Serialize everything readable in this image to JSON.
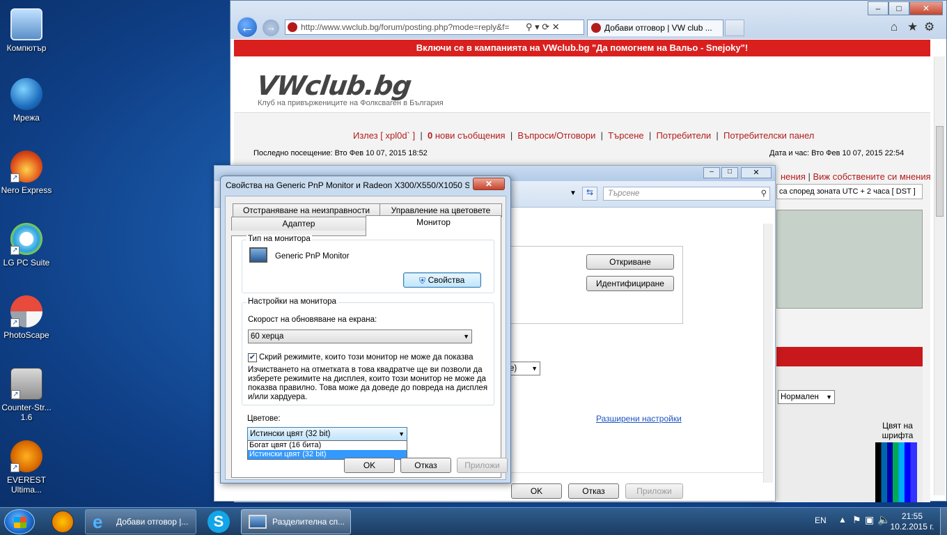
{
  "desktop": {
    "icons": [
      {
        "label": "Компютър",
        "name": "computer"
      },
      {
        "label": "Мрежа",
        "name": "network"
      },
      {
        "label": "Nero Express",
        "name": "nero"
      },
      {
        "label": "LG PC Suite",
        "name": "lg-pc-suite"
      },
      {
        "label": "PhotoScape",
        "name": "photoscape"
      },
      {
        "label": "Counter-Str... 1.6",
        "name": "counter-strike"
      },
      {
        "label": "EVEREST Ultima...",
        "name": "everest"
      }
    ]
  },
  "browser": {
    "url": "http://www.vwclub.bg/forum/posting.php?mode=reply&f=",
    "tab_title": "Добави отговор | VW club ...",
    "banner": "Включи се в кампанията на VWclub.bg \"Да помогнем на Вальо - Snejoky\"!",
    "logo": "VWclub.bg",
    "logo_sub": "Клуб на привържениците на Фолксваген в България",
    "nav": {
      "logout": "Излез [ xpl0d` ]",
      "new_count": "0",
      "new_msgs": " нови съобщения",
      "faq": "Въпроси/Отговори",
      "search": "Търсене",
      "users": "Потребители",
      "panel": "Потребителски панел"
    },
    "last_visit": "Последно посещение: Вто Фев 10 07, 2015 18:52",
    "datetime": "Дата и час: Вто Фев 10 07, 2015 22:54",
    "own_posts_prefix": "нения",
    "own_posts": "Виж собствените си мнения",
    "timezone": "са според зоната UTC + 2 часа [ DST ]",
    "font_size": "Нормален",
    "font_color_label": "Цвят на шрифта"
  },
  "display_dialog": {
    "search_placeholder": "Търсене",
    "detect_button": "Откриване",
    "identify_button": "Идентифициране",
    "advanced_link": "Разширени настройки",
    "ok": "OK",
    "cancel": "Отказ",
    "apply": "Приложи"
  },
  "monitor_dialog": {
    "title": "Свойства на Generic PnP Monitor и Radeon X300/X550/X1050 S...",
    "tabs": {
      "troubleshoot": "Отстраняване на неизправности",
      "color_mgmt": "Управление на цветовете",
      "adapter": "Адаптер",
      "monitor": "Монитор"
    },
    "monitor_type_group": "Тип на монитора",
    "monitor_name": "Generic PnP Monitor",
    "properties_button": "Свойства",
    "settings_group": "Настройки на монитора",
    "refresh_label": "Скорост на обновяване на екрана:",
    "refresh_value": "60 херца",
    "hide_modes_label": "Скрий режимите, които този монитор не може да показва",
    "hide_modes_checked": true,
    "hide_modes_note": "Изчистването на отметката в това квадратче ще ви позволи да изберете режимите на дисплея, които този монитор не може да показва правилно. Това може да доведе до повреда на дисплея и/или хардуера.",
    "colors_label": "Цветове:",
    "colors_value": "Истински цвят (32 bit)",
    "colors_options": [
      "Богат цвят (16 бита)",
      "Истински цвят (32 bit)"
    ],
    "ok": "OK",
    "cancel": "Отказ",
    "apply": "Приложи"
  },
  "taskbar": {
    "items": [
      {
        "label": "Добави отговор |..."
      },
      {
        "label": "Разделителна сп..."
      }
    ],
    "lang": "EN",
    "time": "21:55",
    "date": "10.2.2015 г."
  },
  "colors": {
    "accent_red": "#d9201e",
    "link_red": "#b31b1b",
    "link_blue": "#1a55c0"
  }
}
